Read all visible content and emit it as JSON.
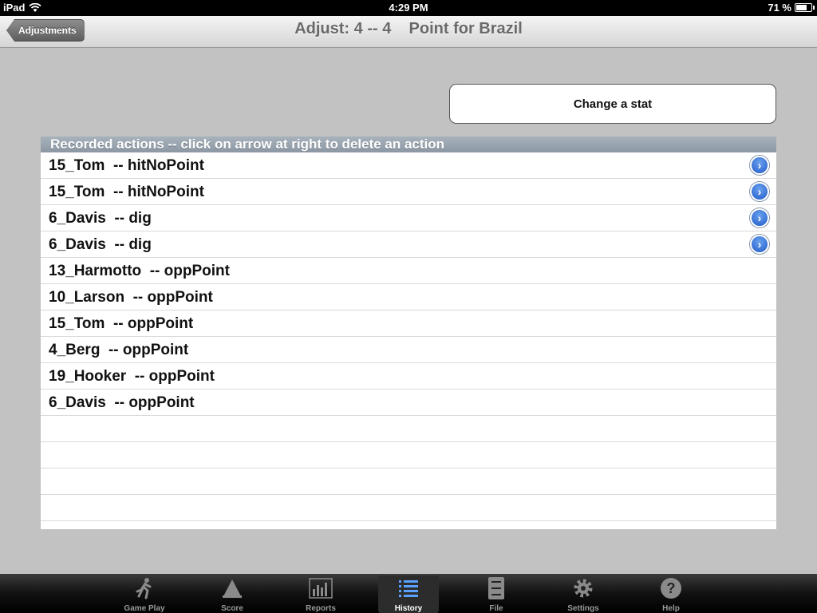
{
  "status_bar": {
    "device": "iPad",
    "time": "4:29 PM",
    "battery": "71 %",
    "battery_level": 0.71
  },
  "nav": {
    "back_label": "Adjustments",
    "title": "Adjust: 4 -- 4    Point for Brazil"
  },
  "change_button": "Change a stat",
  "table": {
    "header": "Recorded actions -- click on arrow at right to delete an action",
    "rows": [
      {
        "label": "15_Tom  -- hitNoPoint",
        "deletable": true
      },
      {
        "label": "15_Tom  -- hitNoPoint",
        "deletable": true
      },
      {
        "label": "6_Davis  -- dig",
        "deletable": true
      },
      {
        "label": "6_Davis  -- dig",
        "deletable": true
      },
      {
        "label": "13_Harmotto  -- oppPoint",
        "deletable": false
      },
      {
        "label": "10_Larson  -- oppPoint",
        "deletable": false
      },
      {
        "label": "15_Tom  -- oppPoint",
        "deletable": false
      },
      {
        "label": "4_Berg  -- oppPoint",
        "deletable": false
      },
      {
        "label": "19_Hooker  -- oppPoint",
        "deletable": false
      },
      {
        "label": "6_Davis  -- oppPoint",
        "deletable": false
      },
      {
        "label": "",
        "deletable": false
      },
      {
        "label": "",
        "deletable": false
      },
      {
        "label": "",
        "deletable": false
      },
      {
        "label": "",
        "deletable": false
      },
      {
        "label": "",
        "deletable": false
      }
    ]
  },
  "tabs": [
    {
      "label": "Game Play",
      "icon": "runner-icon",
      "active": false
    },
    {
      "label": "Score",
      "icon": "cone-icon",
      "active": false
    },
    {
      "label": "Reports",
      "icon": "bar-chart-icon",
      "active": false
    },
    {
      "label": "History",
      "icon": "list-icon",
      "active": true
    },
    {
      "label": "File",
      "icon": "file-cabinet-icon",
      "active": false
    },
    {
      "label": "Settings",
      "icon": "gear-icon",
      "active": false
    },
    {
      "label": "Help",
      "icon": "help-icon",
      "active": false
    }
  ],
  "colors": {
    "accent": "#2159c7",
    "background": "#c2c2c2",
    "active_tab_icon": "#5aa0ff"
  }
}
